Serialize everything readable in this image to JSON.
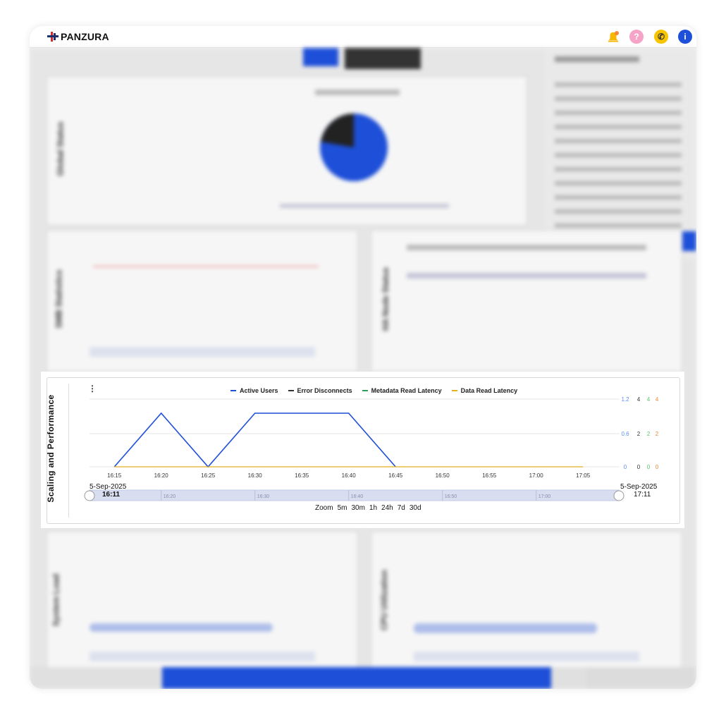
{
  "app": {
    "brand": "PANZURA",
    "colors": {
      "brand_red": "#d42a2a",
      "brand_navy": "#1e2f6b",
      "accent_blue": "#1d4fd8"
    },
    "toolbar_icons": [
      {
        "name": "alerts-icon",
        "color": "#f5b700",
        "glyph": "🔔"
      },
      {
        "name": "help-icon",
        "color": "#f06aa8",
        "glyph": "?"
      },
      {
        "name": "support-icon",
        "color": "#f7c400",
        "glyph": "✆"
      },
      {
        "name": "info-icon",
        "color": "#1d4fd8",
        "glyph": "i"
      }
    ]
  },
  "scaling_panel": {
    "title": "Scaling and Performance",
    "legend": [
      {
        "label": "Active Users",
        "color": "#1d4fd8"
      },
      {
        "label": "Error Disconnects",
        "color": "#333333"
      },
      {
        "label": "Metadata Read Latency",
        "color": "#2e9e5b"
      },
      {
        "label": "Data Read Latency",
        "color": "#e3b020"
      }
    ],
    "start_date": "5-Sep-2025",
    "start_time": "16:11",
    "end_date": "5-Sep-2025",
    "end_time": "17:11",
    "zoom_label": "Zoom",
    "zoom_options": [
      "5m",
      "30m",
      "1h",
      "24h",
      "7d",
      "30d"
    ],
    "navigator_ticks": [
      "16:20",
      "16:30",
      "16:40",
      "16:50",
      "17:00"
    ]
  },
  "chart_data": {
    "type": "line",
    "x_ticks": [
      "16:15",
      "16:20",
      "16:25",
      "16:30",
      "16:35",
      "16:40",
      "16:45",
      "16:50",
      "16:55",
      "17:00",
      "17:05"
    ],
    "xlim": [
      "16:11",
      "17:11"
    ],
    "axes": [
      {
        "series": "Active Users",
        "color": "#5b8ff0",
        "ticks": [
          "0",
          "0.6",
          "1.2"
        ]
      },
      {
        "series": "Error Disconnects",
        "color": "#333333",
        "ticks": [
          "0",
          "2",
          "4"
        ]
      },
      {
        "series": "Metadata Read Latency",
        "color": "#5bc46a",
        "ticks": [
          "0",
          "2",
          "4"
        ]
      },
      {
        "series": "Data Read Latency",
        "color": "#f08a3a",
        "ticks": [
          "0",
          "2",
          "4"
        ]
      }
    ],
    "series": [
      {
        "name": "Active Users",
        "color": "#1d4fd8",
        "x": [
          "16:15",
          "16:20",
          "16:25",
          "16:30",
          "16:40",
          "16:45"
        ],
        "y": [
          0,
          1,
          0,
          1,
          1,
          0
        ]
      },
      {
        "name": "Data Read Latency",
        "color": "#e3b020",
        "x": [
          "16:15",
          "17:05"
        ],
        "y": [
          0,
          0
        ]
      }
    ],
    "grid": true,
    "legend_position": "top"
  }
}
